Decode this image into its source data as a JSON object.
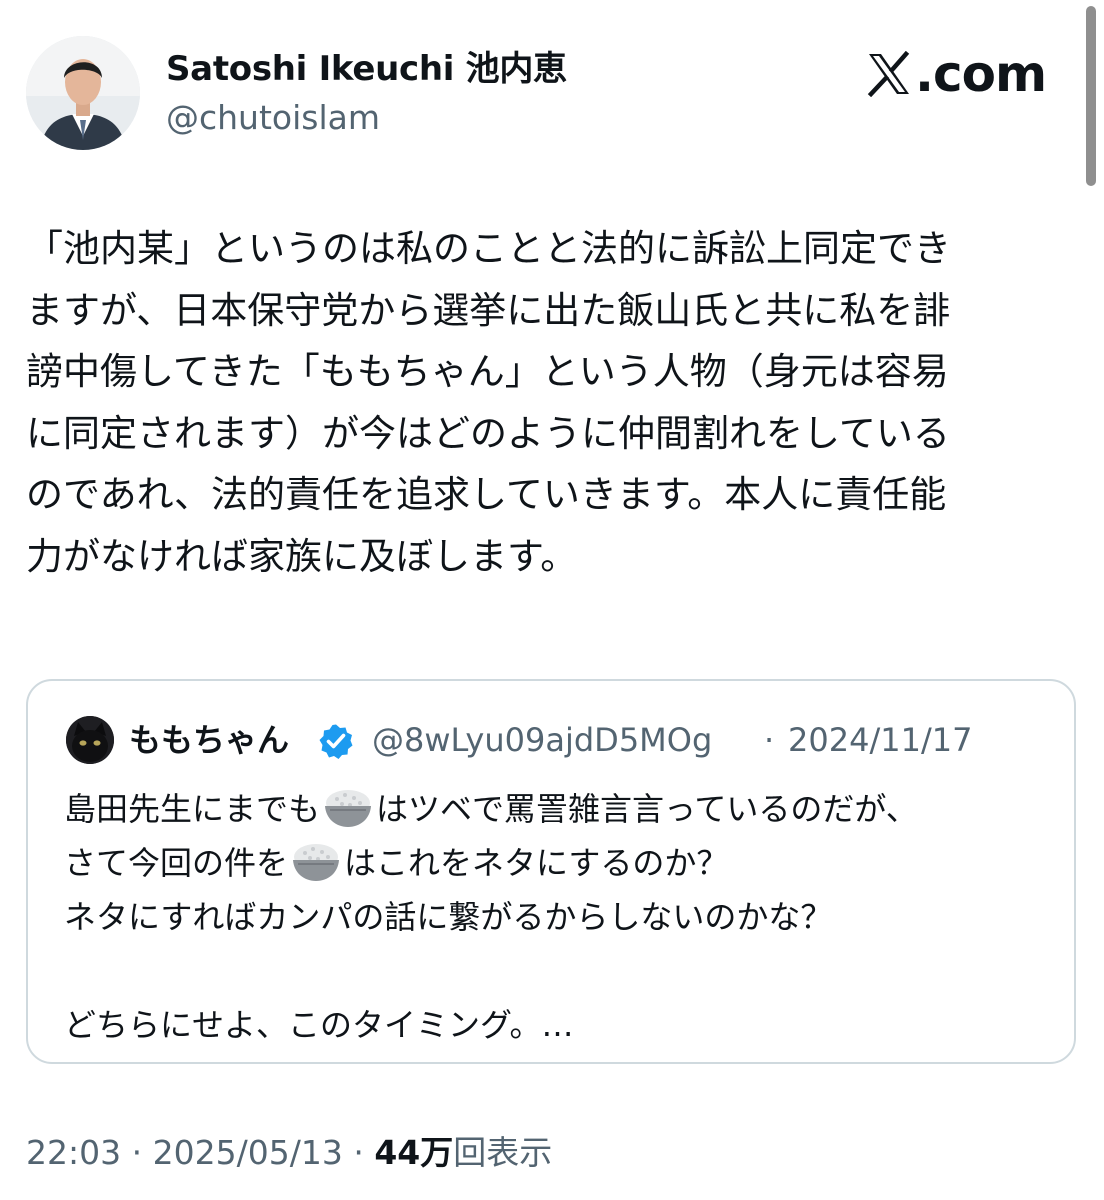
{
  "author": {
    "display_name": "Satoshi Ikeuchi 池内恵",
    "handle": "@chutoislam"
  },
  "brand": {
    "text": ".com",
    "icon": "x-logo-icon"
  },
  "tweet": {
    "lines": [
      "「池内某」というのは私のことと法的に訴訟上同定でき",
      "ますが、日本保守党から選挙に出た飯山氏と共に私を誹",
      "謗中傷してきた「ももちゃん」という人物（身元は容易",
      "に同定されます）が今はどのように仲間割れをしている",
      "のであれ、法的責任を追求していきます。本人に責任能",
      "力がなければ家族に及ぼします。"
    ]
  },
  "quote": {
    "display_name": "ももちゃん",
    "verified_icon": "verified-badge-icon",
    "handle": "@8wLyu09ajdD5MOg",
    "separator": "·",
    "date": "2024/11/17",
    "line1_a": "島田先生にまでも",
    "line1_b": "はツベで罵詈雑言言っているのだが、",
    "line2_a": "さて今回の件を",
    "line2_b": "はこれをネタにするのか？",
    "line3": "ネタにすればカンパの話に繋がるからしないのかな？",
    "line5": "どちらにせよ、このタイミング。…",
    "emoji_icon": "rice-bowl-icon"
  },
  "footer": {
    "time": "22:03",
    "dot1": "·",
    "date": "2025/05/13",
    "dot2": "·",
    "views_count": "44万",
    "views_label": "回表示"
  },
  "colors": {
    "text": "#0f1419",
    "secondary": "#536471",
    "border": "#cfd9de",
    "verified": "#1d9bf0"
  }
}
